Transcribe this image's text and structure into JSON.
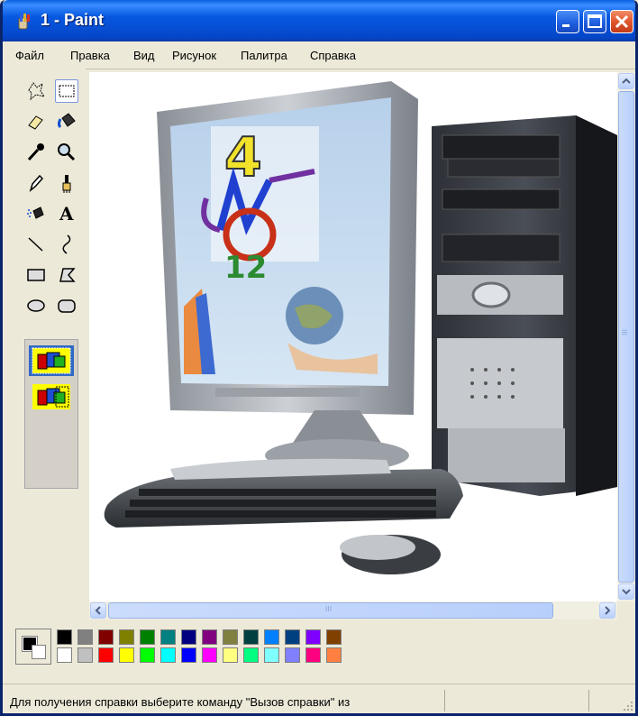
{
  "window": {
    "title": "1 - Paint"
  },
  "menu": [
    "Файл",
    "Правка",
    "Вид",
    "Рисунок",
    "Палитра",
    "Справка"
  ],
  "tools": [
    {
      "name": "free-select-icon",
      "selected": false
    },
    {
      "name": "rect-select-icon",
      "selected": true
    },
    {
      "name": "eraser-icon",
      "selected": false
    },
    {
      "name": "fill-bucket-icon",
      "selected": false
    },
    {
      "name": "color-picker-icon",
      "selected": false
    },
    {
      "name": "magnifier-icon",
      "selected": false
    },
    {
      "name": "pencil-icon",
      "selected": false
    },
    {
      "name": "brush-icon",
      "selected": false
    },
    {
      "name": "airbrush-icon",
      "selected": false
    },
    {
      "name": "text-icon",
      "selected": false
    },
    {
      "name": "line-icon",
      "selected": false
    },
    {
      "name": "curve-icon",
      "selected": false
    },
    {
      "name": "rectangle-icon",
      "selected": false
    },
    {
      "name": "polygon-icon",
      "selected": false
    },
    {
      "name": "ellipse-icon",
      "selected": false
    },
    {
      "name": "rounded-rect-icon",
      "selected": false
    }
  ],
  "text_tool_glyph": "A",
  "scrollbar_grip": "III",
  "palette": {
    "foreground": "#000000",
    "background": "#ffffff",
    "row1": [
      "#000000",
      "#808080",
      "#800000",
      "#808000",
      "#008000",
      "#008080",
      "#000080",
      "#800080",
      "#808040",
      "#004040",
      "#0080ff",
      "#004080",
      "#8000ff",
      "#804000"
    ],
    "row2": [
      "#ffffff",
      "#c0c0c0",
      "#ff0000",
      "#ffff00",
      "#00ff00",
      "#00ffff",
      "#0000ff",
      "#ff00ff",
      "#ffff80",
      "#00ff80",
      "#80ffff",
      "#8080ff",
      "#ff0080",
      "#ff8040"
    ]
  },
  "status": {
    "text": "Для получения справки выберите команду \"Вызов справки\" из"
  }
}
